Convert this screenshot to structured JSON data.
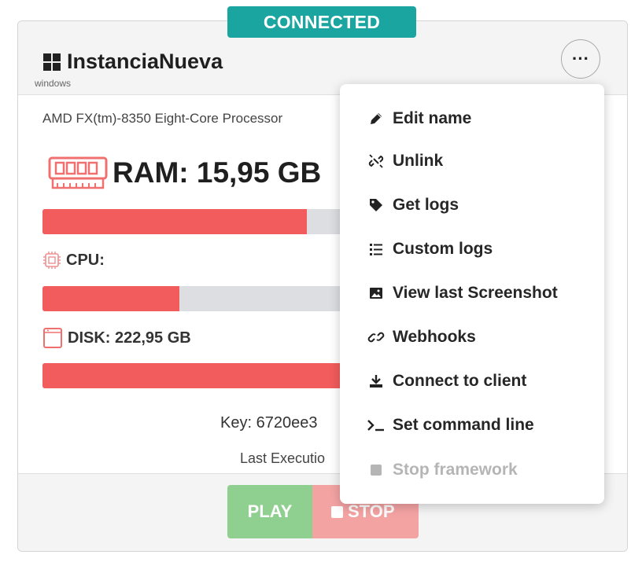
{
  "status": {
    "label": "CONNECTED",
    "color": "#1aa5a0"
  },
  "instance": {
    "icon": "windows-logo-icon",
    "title": "InstanciaNueva",
    "os": "windows",
    "more_label": "···",
    "processor": "AMD FX(tm)-8350 Eight-Core Processor"
  },
  "resources": {
    "ram": {
      "label": "RAM: 15,95 GB",
      "icon": "ram-icon",
      "usage_fraction": 0.56
    },
    "cpu": {
      "label": "CPU:",
      "icon": "cpu-icon",
      "usage_fraction": 0.29
    },
    "disk": {
      "label": "DISK: 222,95 GB",
      "icon": "disk-icon",
      "usage_fraction": 0.97
    },
    "bar_color": "#f25c5c",
    "track_color": "#dcdee2"
  },
  "key_text": "Key: 6720ee3",
  "last_execution_text": "Last Executio",
  "buttons": {
    "play": "PLAY",
    "stop": "STOP",
    "play_color": "#8fcf8f",
    "stop_color": "#f4a3a3"
  },
  "menu": {
    "items": [
      {
        "label": "Edit name",
        "icon": "pencil-icon",
        "disabled": false
      },
      {
        "label": "Unlink",
        "icon": "unlink-icon",
        "disabled": false
      },
      {
        "label": "Get logs",
        "icon": "tag-icon",
        "disabled": false
      },
      {
        "label": "Custom logs",
        "icon": "list-icon",
        "disabled": false
      },
      {
        "label": "View last Screenshot",
        "icon": "image-icon",
        "disabled": false
      },
      {
        "label": "Webhooks",
        "icon": "link-icon",
        "disabled": false
      },
      {
        "label": "Connect to client",
        "icon": "download-icon",
        "disabled": false
      },
      {
        "label": "Set command line",
        "icon": "terminal-icon",
        "disabled": false
      },
      {
        "label": "Stop framework",
        "icon": "stop-icon",
        "disabled": true
      }
    ]
  }
}
